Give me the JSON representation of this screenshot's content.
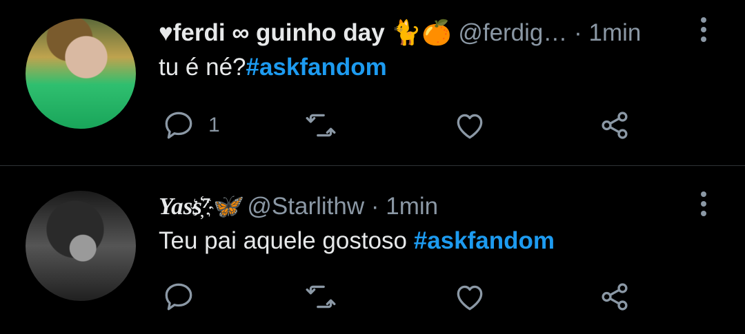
{
  "tweets": [
    {
      "display_name": "♥ferdi ∞ guinho day 🐈🍊",
      "handle": "@ferdig…",
      "separator": "·",
      "time": "1min",
      "text": "tu é né?",
      "hashtag": "#askfandom",
      "reply_count": "1"
    },
    {
      "display_name": "Yass҉⁷🦋",
      "handle": "@Starlithw",
      "separator": "·",
      "time": "1min",
      "text": "Teu pai aquele gostoso ",
      "hashtag": "#askfandom",
      "reply_count": ""
    }
  ],
  "colors": {
    "background": "#000000",
    "text": "#e7e9ea",
    "secondary": "#8b98a5",
    "hashtag": "#1d9bf0",
    "divider": "#2f3336"
  },
  "icons": [
    "reply-icon",
    "retweet-icon",
    "like-icon",
    "share-icon",
    "more-options-icon"
  ]
}
